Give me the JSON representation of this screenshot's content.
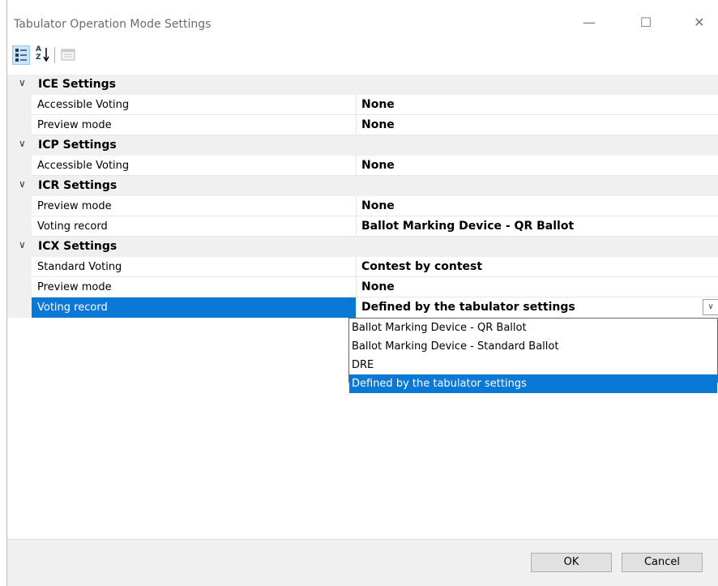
{
  "window": {
    "title": "Tabulator Operation Mode Settings",
    "minimize_glyph": "—",
    "maximize_glyph": "☐",
    "close_glyph": "✕"
  },
  "toolbar": {
    "categorized_icon": "categorized-icon",
    "alphabetical_icon": "alphabetical-sort-icon",
    "property_pages_icon": "property-pages-icon",
    "alphabetical_a": "A",
    "alphabetical_z": "Z"
  },
  "grid": {
    "chevron": "∨",
    "categories": [
      {
        "title": "ICE Settings",
        "properties": [
          {
            "name": "Accessible Voting",
            "value": "None"
          },
          {
            "name": "Preview mode",
            "value": "None"
          }
        ]
      },
      {
        "title": "ICP Settings",
        "properties": [
          {
            "name": "Accessible Voting",
            "value": "None"
          }
        ]
      },
      {
        "title": "ICR Settings",
        "properties": [
          {
            "name": "Preview mode",
            "value": "None"
          },
          {
            "name": "Voting record",
            "value": "Ballot Marking Device - QR Ballot"
          }
        ]
      },
      {
        "title": "ICX Settings",
        "properties": [
          {
            "name": "Standard Voting",
            "value": "Contest by contest"
          },
          {
            "name": "Preview mode",
            "value": "None"
          },
          {
            "name": "Voting record",
            "value": "Defined by the tabulator settings"
          }
        ]
      }
    ],
    "dropdown_arrow": "∨"
  },
  "dropdown": {
    "options": [
      "Ballot Marking Device - QR Ballot",
      "Ballot Marking Device - Standard Ballot",
      "DRE",
      "Defined by the tabulator settings"
    ],
    "selected_option": "Defined by the tabulator settings"
  },
  "buttons": {
    "ok": "OK",
    "cancel": "Cancel"
  },
  "colors": {
    "selection": "#0a78d7",
    "category_background": "#f0f0f0"
  }
}
